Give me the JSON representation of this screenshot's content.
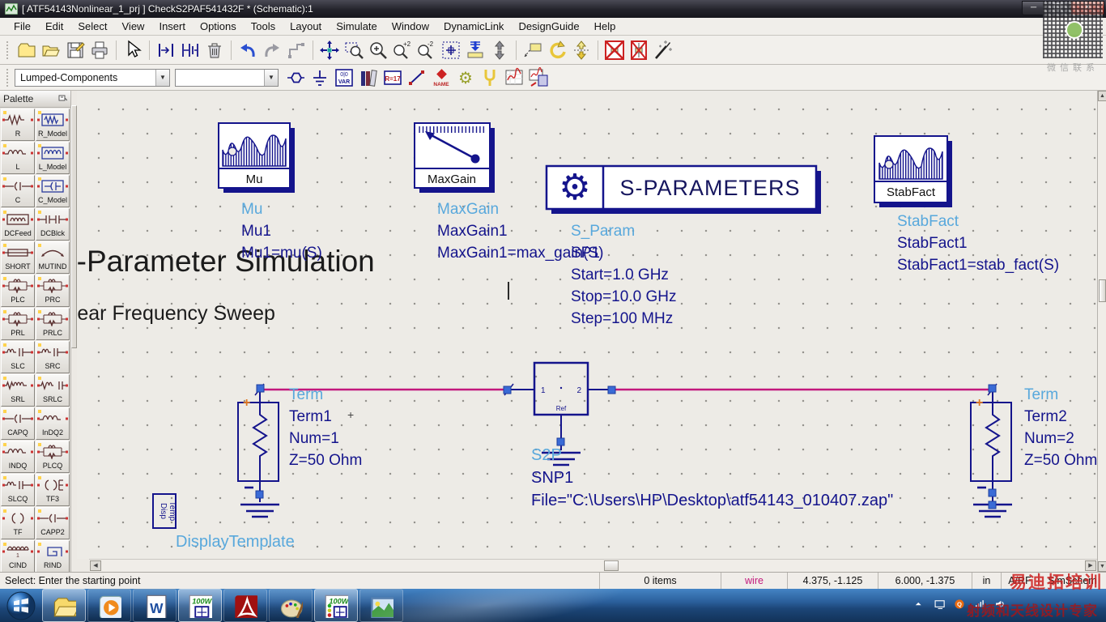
{
  "colors": {
    "wire": "#c2187c",
    "component": "#14148c",
    "label": "#58a8dc",
    "select_handle": "#3a6bd6",
    "polarity": "#e07820",
    "annotation": "#1b1b1b"
  },
  "window": {
    "title": "[ ATF54143Nonlinear_1_prj ] CheckS2PAF541432F * (Schematic):1",
    "controls": [
      {
        "name": "minimize",
        "glyph": "─"
      },
      {
        "name": "maximize",
        "glyph": "❐"
      },
      {
        "name": "close",
        "glyph": "✕"
      }
    ]
  },
  "menubar": [
    "File",
    "Edit",
    "Select",
    "View",
    "Insert",
    "Options",
    "Tools",
    "Layout",
    "Simulate",
    "Window",
    "DynamicLink",
    "DesignGuide",
    "Help"
  ],
  "toolbar_main": [
    "new",
    "open",
    "save",
    "print",
    "|",
    "pointer",
    "|",
    "insert-pin",
    "insert-pins",
    "delete",
    "|",
    "undo",
    "redo",
    "route",
    "|",
    "move",
    "zoom-area",
    "zoom-in",
    "zoom-in-x2",
    "zoom-out-x2",
    "zoom-fit",
    "push-into-hierarchy",
    "pop-out-of-hierarchy",
    "|",
    "wire-label",
    "rotate",
    "mirror",
    "|",
    "deactivate",
    "deactivate-short",
    "simulation-wizard"
  ],
  "toolbar_insert": {
    "category": "Lumped-Components",
    "part_value": "",
    "icons": [
      "port",
      "ground",
      "var",
      "library",
      "display-params",
      "wire",
      "name",
      "gears",
      "tune",
      "plot",
      "save-plot"
    ]
  },
  "palette": {
    "title": "Palette",
    "items": [
      {
        "label": "R",
        "icon": "res"
      },
      {
        "label": "R_Model",
        "icon": "resbox"
      },
      {
        "label": "L",
        "icon": "ind"
      },
      {
        "label": "L_Model",
        "icon": "indbox"
      },
      {
        "label": "C",
        "icon": "cap"
      },
      {
        "label": "C_Model",
        "icon": "capbox"
      },
      {
        "label": "DCFeed",
        "icon": "coilbox"
      },
      {
        "label": "DCBlck",
        "icon": "dcblk"
      },
      {
        "label": "SHORT",
        "icon": "short"
      },
      {
        "label": "MUTIND",
        "icon": "mutind"
      },
      {
        "label": "PLC",
        "icon": "par"
      },
      {
        "label": "PRC",
        "icon": "par"
      },
      {
        "label": "PRL",
        "icon": "par"
      },
      {
        "label": "PRLC",
        "icon": "par"
      },
      {
        "label": "SLC",
        "icon": "ser"
      },
      {
        "label": "SRC",
        "icon": "ser"
      },
      {
        "label": "SRL",
        "icon": "srl"
      },
      {
        "label": "SRLC",
        "icon": "srlc"
      },
      {
        "label": "CAPQ",
        "icon": "cap"
      },
      {
        "label": "InDQ2",
        "icon": "ind"
      },
      {
        "label": "INDQ",
        "icon": "ind"
      },
      {
        "label": "PLCQ",
        "icon": "par"
      },
      {
        "label": "SLCQ",
        "icon": "ser"
      },
      {
        "label": "TF3",
        "icon": "tf3"
      },
      {
        "label": "TF",
        "icon": "tf"
      },
      {
        "label": "CAPP2",
        "icon": "cap"
      },
      {
        "label": "CIND",
        "icon": "cind"
      },
      {
        "label": "RIND",
        "icon": "rind"
      }
    ]
  },
  "schematic": {
    "title_text": "S-Parameter Simulation",
    "subtitle_text": "Linear Frequency Sweep",
    "meas_mu": {
      "box_label": "Mu",
      "name": "Mu",
      "inst": "Mu1",
      "expr": "Mu1=mu(S)"
    },
    "meas_maxgain": {
      "box_label": "MaxGain",
      "name": "MaxGain",
      "inst": "MaxGain1",
      "expr": "MaxGain1=max_gain(S)"
    },
    "meas_stabfact": {
      "box_label": "StabFact",
      "name": "StabFact",
      "inst": "StabFact1",
      "expr": "StabFact1=stab_fact(S)"
    },
    "sparam_block": {
      "box_label": "S-PARAMETERS",
      "name": "S_Param",
      "inst": "SP1",
      "params": [
        "Start=1.0 GHz",
        "Stop=10.0 GHz",
        "Step=100 MHz"
      ]
    },
    "term1": {
      "name": "Term",
      "inst": "Term1",
      "params": [
        "Num=1",
        "Z=50 Ohm"
      ]
    },
    "term2": {
      "name": "Term",
      "inst": "Term2",
      "params": [
        "Num=2",
        "Z=50 Ohm"
      ]
    },
    "s2p": {
      "name": "S2P",
      "inst": "SNP1",
      "file_param": "File=\"C:\\Users\\HP\\Desktop\\atf54143_010407.zap\"",
      "pin1": "1",
      "pin2": "2",
      "ref": "Ref"
    },
    "display_template": {
      "box_lines": [
        "Disp",
        "Temp"
      ],
      "label": "DisplayTemplate"
    }
  },
  "statusbar": {
    "message": "Select: Enter the starting point",
    "items_count": "0 items",
    "mode": "wire",
    "cursor_xy": "4.375, -1.125",
    "snap_xy": "6.000, -1.375",
    "units": "in",
    "tech": "A/RF",
    "view_type": "SimSchem"
  },
  "taskbar": {
    "apps": [
      "windows-explorer",
      "media-player",
      "word",
      "ads-schematic",
      "adobe-reader",
      "paint",
      "ads-simulator",
      "photo-viewer"
    ],
    "tray": [
      "hidden-icons",
      "display",
      "qq",
      "network",
      "volume"
    ]
  },
  "watermarks": {
    "qr_caption": "微信联系",
    "brand": "易迪拓培训",
    "slogan": "射频和天线设计专家"
  }
}
